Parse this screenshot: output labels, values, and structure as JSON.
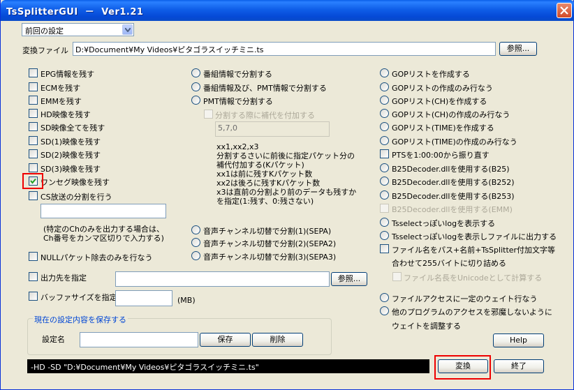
{
  "window": {
    "title": "TsSplitterGUI  －  Ver1.21"
  },
  "preset": {
    "value": "前回の設定"
  },
  "input_file": {
    "label": "変換ファイル",
    "value": "D:¥Document¥My Videos¥ピタゴラスイッチミニ.ts",
    "browse": "参照..."
  },
  "col1": {
    "epg": "EPG情報を残す",
    "ecm": "ECMを残す",
    "emm": "EMMを残す",
    "hd": "HD映像を残す",
    "sd_all": "SD映像全てを残す",
    "sd1": "SD(1)映像を残す",
    "sd2": "SD(2)映像を残す",
    "sd3": "SD(3)映像を残す",
    "oneseg": "ワンセグ映像を残す",
    "cs": "CS放送の分割を行う",
    "ch_note": "(特定のChのみを出力する場合は、\nCh番号をカンマ区切りで入力する)",
    "null_packet": "NULLパケット除去のみを行なう"
  },
  "col2": {
    "split_prog": "番組情報で分割する",
    "split_prog_pmt": "番組情報及び、PMT情報で分割する",
    "split_pmt": "PMT情報で分割する",
    "add_suffix": "分割する際に補代を付加する",
    "suffix_value": "5,7,0",
    "suffix_note": "xx1,xx2,x3\n分割するさいに前後に指定パケット分の\n補代付加する(Kパケット)\nxx1は前に残すKパケット数\nxx2は後ろに残すKパケット数\nx3は直前の分割より前のデータも残すか\nを指定(1:残す、0:残さない)",
    "audio1": "音声チャンネル切替で分割(1)(SEPA)",
    "audio2": "音声チャンネル切替で分割(2)(SEPA2)",
    "audio3": "音声チャンネル切替で分割(3)(SEPA3)"
  },
  "col3": {
    "gop": "GOPリストを作成する",
    "gop_only": "GOPリストの作成のみ行なう",
    "gop_ch": "GOPリスト(CH)を作成する",
    "gop_ch_only": "GOPリスト(CH)の作成のみ行なう",
    "gop_time": "GOPリスト(TIME)を作成する",
    "gop_time_only": "GOPリスト(TIME)の作成のみ行なう",
    "pts": "PTSを1:00:00から振り直す",
    "b25": "B25Decoder.dllを使用する(B25)",
    "b252": "B25Decoder.dllを使用する(B252)",
    "b253": "B25Decoder.dllを使用する(B253)",
    "emm": "B25Decoder.dllを使用する(EMM)",
    "tsselect_log": "Tsselectっぽいlogを表示する",
    "tsselect_log_file": "Tsselectっぽいlogを表示しファイルに出力する",
    "filename_line1": "ファイル名をパス+名前+TsSplitter付加文字等",
    "filename_line2": "合わせて255バイトに切り詰める",
    "unicode": "ファイル名長をUnicodeとして計算する",
    "wait": "ファイルアクセスに一定のウェイト行なう",
    "adjust_line1": "他のプログラムのアクセスを邪魔しないように",
    "adjust_line2": "ウェイトを調整する"
  },
  "output": {
    "label": "出力先を指定",
    "browse": "参照..."
  },
  "buffer": {
    "label": "バッファサイズを指定",
    "unit": "(MB)"
  },
  "save_group": {
    "title": "現在の設定内容を保存する",
    "name_label": "設定名",
    "save": "保存",
    "delete": "削除"
  },
  "cmdline": "-HD -SD \"D:¥Document¥My Videos¥ピタゴラスイッチミニ.ts\"",
  "buttons": {
    "help": "Help",
    "convert": "変換",
    "exit": "終了"
  },
  "colors": {
    "title_bar": "#0a5fe8",
    "highlight": "#e00000",
    "group_title": "#0046d5"
  }
}
